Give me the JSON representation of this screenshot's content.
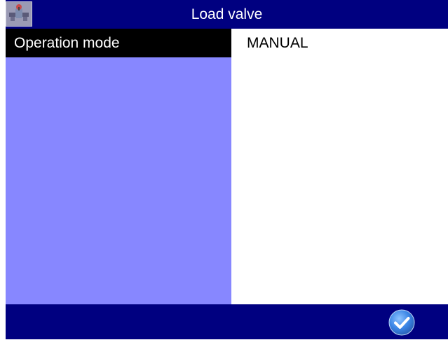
{
  "header": {
    "title": "Load valve",
    "icon": "valve-app-icon"
  },
  "parameters": [
    {
      "label": "Operation mode",
      "value": "MANUAL",
      "selected": true
    }
  ],
  "footer": {
    "confirm_icon": "checkmark-icon"
  },
  "colors": {
    "bar": "#000080",
    "list_background": "#8787ff",
    "selected_row": "#000000",
    "value_background": "#ffffff",
    "confirm_button": "#4a90e2"
  }
}
